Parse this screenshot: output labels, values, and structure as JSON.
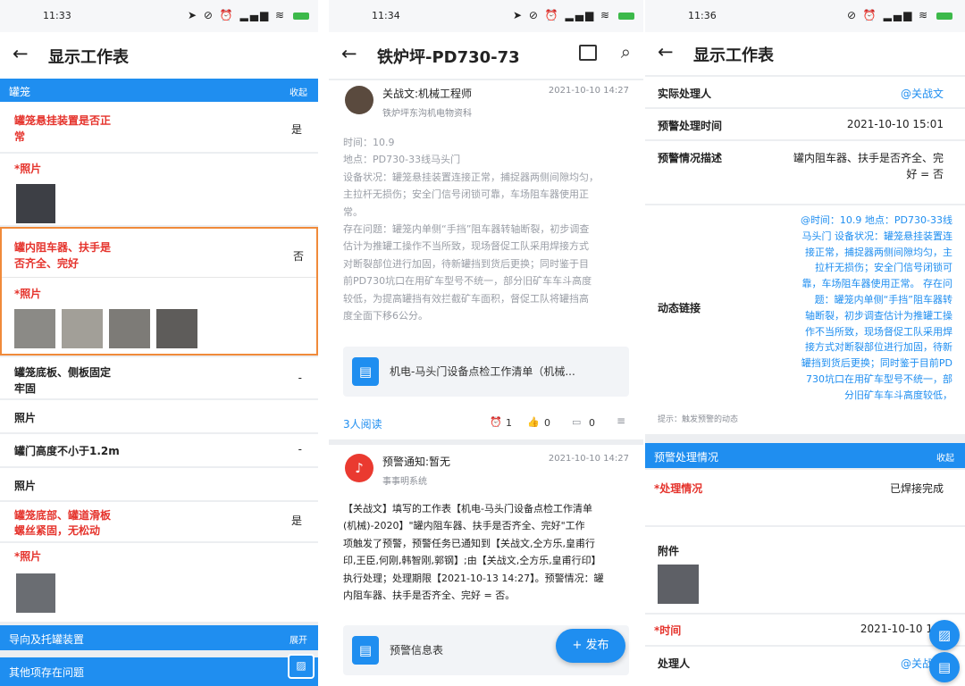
{
  "s1": {
    "time": "11:33",
    "title": "显示工作表",
    "section1": {
      "label": "罐笼",
      "action": "收起"
    },
    "item1": {
      "label_line1": "罐笼悬挂装置是否正",
      "label_line2": "常",
      "value": "是"
    },
    "photo_label": "*照片",
    "item2": {
      "label_line1": "罐内阻车器、扶手是",
      "label_line2": "否齐全、完好",
      "value": "否"
    },
    "item3": {
      "label_line1": "罐笼底板、侧板固定",
      "label_line2": "牢固",
      "value": "-"
    },
    "photo_plain": "照片",
    "item4": {
      "label": "罐门高度不小于1.2m",
      "value": "-"
    },
    "item5": {
      "label_line1": "罐笼底部、罐道滑板",
      "label_line2": "螺丝紧固，无松动",
      "value": "是"
    },
    "section2": {
      "label": "导向及托罐装置",
      "action": "展开"
    },
    "section3": {
      "label": "其他项存在问题"
    }
  },
  "s2": {
    "time": "11:34",
    "title": "铁炉坪-PD730-73",
    "post1": {
      "author": "关战文:机械工程师",
      "org": "铁炉坪东沟机电物资科",
      "date": "2021-10-10 14:27",
      "body_lines": [
        "时间：10.9",
        "地点：PD730-33线马头门",
        "设备状况：罐笼悬挂装置连接正常，捕捉器两侧间隙均匀，",
        "主拉杆无损伤；安全门信号闭锁可靠，车场阻车器使用正",
        "常。",
        "存在问题：罐笼内单侧“手挡”阻车器转轴断裂，初步调查",
        "估计为推罐工操作不当所致，现场督促工队采用焊接方式",
        "对断裂部位进行加固，待新罐挡到货后更换；同时鉴于目",
        "前PD730坑口在用矿车型号不统一，部分旧矿车车斗高度",
        "较低，为提高罐挡有效拦截矿车面积，督促工队将罐挡高",
        "度全面下移6公分。"
      ],
      "attachment": "机电-马头门设备点检工作清单（机械...",
      "reads": "3人阅读",
      "stat1": "1",
      "stat2": "0",
      "stat3": "0"
    },
    "post2": {
      "author": "预警通知:暂无",
      "org": "事事明系统",
      "date": "2021-10-10 14:27",
      "body_lines": [
        "【关战文】填写的工作表【机电-马头门设备点检工作清单",
        "(机械)-2020】\"罐内阻车器、扶手是否齐全、完好\"工作",
        "项触发了预警，预警任务已通知到【关战文,仝方乐,皇甫行",
        "印,王臣,何刚,韩智刚,郭钢】;由【关战文,仝方乐,皇甫行印】",
        "执行处理；处理期限【2021-10-13 14:27】。预警情况：罐",
        "内阻车器、扶手是否齐全、完好 = 否。"
      ],
      "attachment": "预警信息表"
    },
    "publish": "+ 发布"
  },
  "s3": {
    "time": "11:36",
    "title": "显示工作表",
    "handler_label": "实际处理人",
    "handler_value": "@关战文",
    "warn_time_label": "预警处理时间",
    "warn_time_value": "2021-10-10 15:01",
    "warn_desc_label": "预警情况描述",
    "warn_desc_lines": [
      "罐内阻车器、扶手是否齐全、完",
      "好 = 否"
    ],
    "dyn_label": "动态链接",
    "dyn_lines": [
      "@时间：10.9 地点：PD730-33线",
      "马头门 设备状况：罐笼悬挂装置连",
      "接正常，捕捉器两侧间隙均匀，主",
      "拉杆无损伤；安全门信号闭锁可",
      "靠，车场阻车器使用正常。 存在问",
      "题：罐笼内单侧“手挡”阻车器转",
      "轴断裂，初步调查估计为推罐工操",
      "作不当所致，现场督促工队采用焊",
      "接方式对断裂部位进行加固，待新",
      "罐挡到货后更换；同时鉴于目前PD",
      "730坑口在用矿车型号不统一，部",
      "分旧矿车车斗高度较低，"
    ],
    "hint": "提示：触发预警的动态",
    "section": {
      "label": "预警处理情况",
      "action": "收起"
    },
    "status_label": "*处理情况",
    "status_value": "已焊接完成",
    "attach_label": "附件",
    "time_label": "*时间",
    "time_value": "2021-10-10 1",
    "person_label": "处理人",
    "person_value": "@关战"
  }
}
